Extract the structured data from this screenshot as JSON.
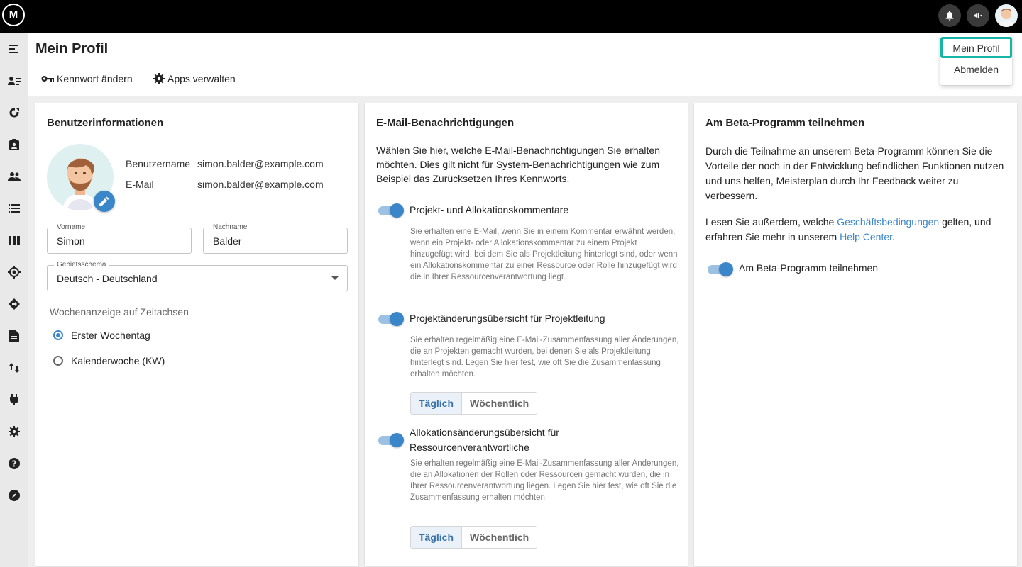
{
  "topbar": {
    "logo_text": "M",
    "icons": [
      "bell-icon",
      "megaphone-icon"
    ]
  },
  "sidebar": {
    "items": [
      {
        "icon": "menu-collapse-icon"
      },
      {
        "icon": "people-list-icon"
      },
      {
        "icon": "refresh-icon"
      },
      {
        "icon": "clipboard-user-icon"
      },
      {
        "icon": "group-icon"
      },
      {
        "icon": "list-icon"
      },
      {
        "icon": "columns-icon"
      },
      {
        "icon": "target-icon"
      },
      {
        "icon": "route-icon"
      },
      {
        "icon": "document-icon"
      },
      {
        "icon": "arrows-updown-icon"
      },
      {
        "icon": "plug-icon"
      },
      {
        "icon": "gear-icon"
      },
      {
        "icon": "help-icon"
      },
      {
        "icon": "compass-icon"
      }
    ]
  },
  "header": {
    "title": "Mein Profil",
    "actions": {
      "change_password": "Kennwort ändern",
      "manage_apps": "Apps verwalten"
    }
  },
  "user_menu": {
    "profile": "Mein Profil",
    "logout": "Abmelden"
  },
  "profile_card": {
    "title": "Benutzerinformationen",
    "username_label": "Benutzername",
    "username_value": "simon.balder@example.com",
    "email_label": "E-Mail",
    "email_value": "simon.balder@example.com",
    "firstname_label": "Vorname",
    "firstname_value": "Simon",
    "lastname_label": "Nachname",
    "lastname_value": "Balder",
    "locale_label": "Gebietsschema",
    "locale_value": "Deutsch - Deutschland",
    "week_section_label": "Wochenanzeige auf Zeitachsen",
    "week_options": [
      {
        "label": "Erster Wochentag",
        "selected": true
      },
      {
        "label": "Kalenderwoche (KW)",
        "selected": false
      }
    ]
  },
  "email_card": {
    "title": "E-Mail-Benachrichtigungen",
    "intro": "Wählen Sie hier, welche E-Mail-Benachrichtigungen Sie erhalten möchten. Dies gilt nicht für System-Benachrichtigungen wie zum Beispiel das Zurücksetzen Ihres Kennworts.",
    "options": [
      {
        "title": "Projekt- und Allokationskommentare",
        "enabled": true,
        "description": "Sie erhalten eine E-Mail, wenn Sie in einem Kommentar erwähnt werden, wenn ein Projekt- oder Allokationskommentar zu einem Projekt hinzugefügt wird, bei dem Sie als Projektleitung hinterlegt sind, oder wenn ein Allokationskommentar zu einer Ressource oder Rolle hinzugefügt wird, die in Ihrer Ressourcenverantwortung liegt."
      },
      {
        "title": "Projektänderungsübersicht für Projektleitung",
        "enabled": true,
        "description": "Sie erhalten regelmäßig eine E-Mail-Zusammenfassung aller Änderungen, die an Projekten gemacht wurden, bei denen Sie als Projektleitung hinterlegt sind. Legen Sie hier fest, wie oft Sie die Zusammenfassung erhalten möchten.",
        "frequency": {
          "daily": "Täglich",
          "weekly": "Wöchentlich",
          "selected": "daily"
        }
      },
      {
        "title": "Allokationsänderungsübersicht für Ressourcenverantwortliche",
        "enabled": true,
        "description": "Sie erhalten regelmäßig eine E-Mail-Zusammenfassung aller Änderungen, die an Allokationen der Rollen oder Ressourcen gemacht wurden, die in Ihrer Ressourcenverantwortung liegen. Legen Sie hier fest, wie oft Sie die Zusammenfassung erhalten möchten.",
        "frequency": {
          "daily": "Täglich",
          "weekly": "Wöchentlich",
          "selected": "daily"
        }
      }
    ]
  },
  "beta_card": {
    "title": "Am Beta-Programm teilnehmen",
    "intro": "Durch die Teilnahme an unserem Beta-Programm können Sie die Vorteile der noch in der Entwicklung befindlichen Funktionen nutzen und uns helfen, Meisterplan durch Ihr Feedback weiter zu verbessern.",
    "terms_prefix": "Lesen Sie außerdem, welche ",
    "terms_link": "Geschäftsbedingungen",
    "terms_middle": " gelten, und erfahren Sie mehr in unserem ",
    "help_link": "Help Center",
    "terms_suffix": ".",
    "toggle_label": "Am Beta-Programm teilnehmen",
    "toggle_enabled": true
  },
  "colors": {
    "accent": "#3a86c8",
    "menu_highlight": "#16b5a5",
    "topbar": "#000000"
  }
}
